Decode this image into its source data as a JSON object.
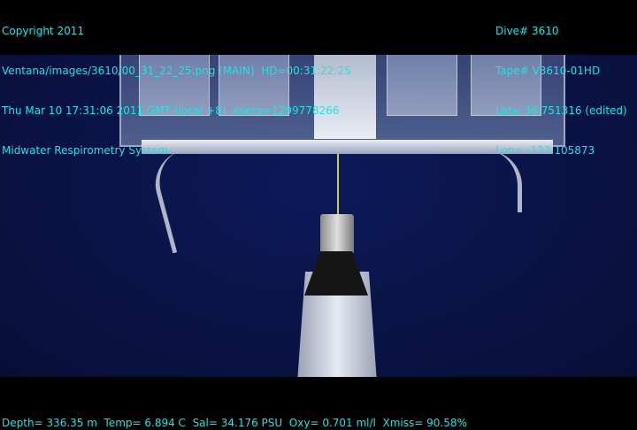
{
  "overlay": {
    "top_left": [
      "Copyright 2011",
      "Ventana/images/3610/00_31_22_25.png (MAIN)  HD=00:31:22:25",
      "Thu Mar 10 17:31:06 2011 GMT (local +8)  esecs=1299778266",
      "Midwater Respirometry System"
    ],
    "top_right": [
      "Dive# 3610",
      "Tape# V3610-01HD",
      "Lat= 36.751316 (edited)",
      "Lon= -122.105873"
    ],
    "bottom": "Depth= 336.35 m  Temp= 6.894 C  Sal= 34.176 PSU  Oxy= 0.701 ml/l  Xmiss= 90.58%"
  },
  "colors": {
    "overlay_text": "#19e6e6",
    "water": "#0a1448"
  }
}
